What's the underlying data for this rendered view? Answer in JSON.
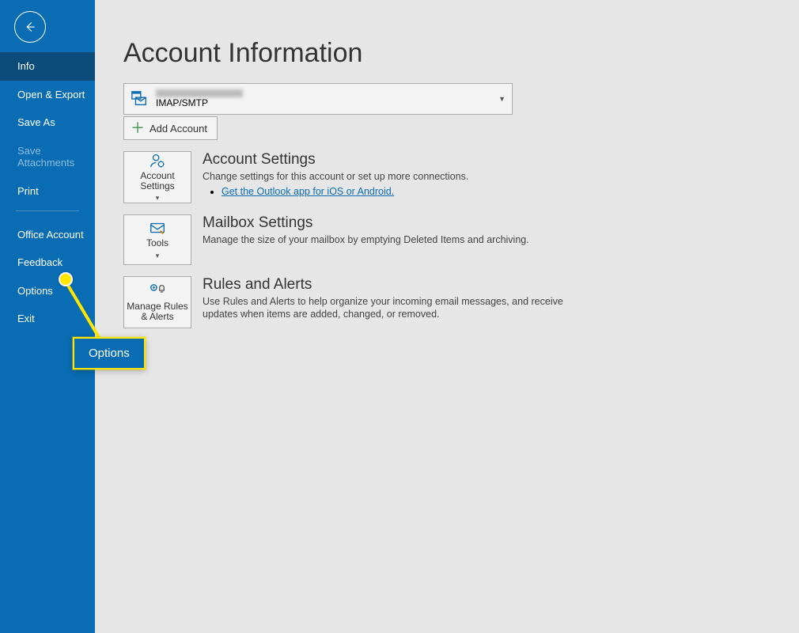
{
  "sidebar": {
    "items": [
      {
        "label": "Info",
        "active": true,
        "disabled": false
      },
      {
        "label": "Open & Export",
        "active": false,
        "disabled": false
      },
      {
        "label": "Save As",
        "active": false,
        "disabled": false
      },
      {
        "label": "Save Attachments",
        "active": false,
        "disabled": true
      },
      {
        "label": "Print",
        "active": false,
        "disabled": false
      }
    ],
    "items2": [
      {
        "label": "Office Account"
      },
      {
        "label": "Feedback"
      },
      {
        "label": "Options"
      },
      {
        "label": "Exit"
      }
    ]
  },
  "main": {
    "title": "Account Information",
    "account_type": "IMAP/SMTP",
    "add_account": "Add Account",
    "sections": [
      {
        "tile_label": "Account Settings",
        "heading": "Account Settings",
        "desc": "Change settings for this account or set up more connections.",
        "link": "Get the Outlook app for iOS or Android."
      },
      {
        "tile_label": "Tools",
        "heading": "Mailbox Settings",
        "desc": "Manage the size of your mailbox by emptying Deleted Items and archiving."
      },
      {
        "tile_label": "Manage Rules & Alerts",
        "heading": "Rules and Alerts",
        "desc": "Use Rules and Alerts to help organize your incoming email messages, and receive updates when items are added, changed, or removed."
      }
    ]
  },
  "callout": {
    "label": "Options"
  }
}
